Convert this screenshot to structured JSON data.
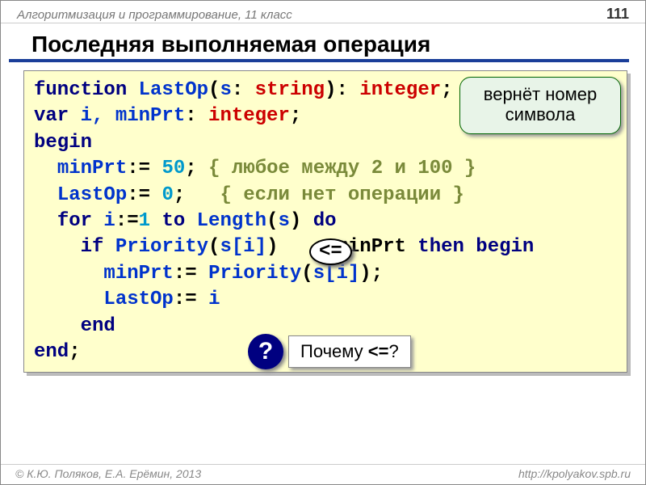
{
  "header": {
    "course": "Алгоритмизация и программирование, 11 класс",
    "page": "111"
  },
  "title": "Последняя выполняемая операция",
  "code": {
    "l1": {
      "kw1": "function ",
      "name": "LastOp",
      "paren1": "(",
      "p": "s",
      "colon1": ": ",
      "t1": "string",
      "paren2": "): ",
      "t2": "integer",
      "semi": ";"
    },
    "l2": {
      "kw": "var ",
      "vars": "i, minPrt",
      "colon": ": ",
      "t": "integer",
      "semi": ";"
    },
    "l3": {
      "kw": "begin"
    },
    "l4": {
      "indent": "  ",
      "v": "minPrt",
      "assign": ":= ",
      "n": "50",
      "semi": "; ",
      "c": "{ любое между 2 и 100 }"
    },
    "l5": {
      "indent": "  ",
      "v": "LastOp",
      "assign": ":= ",
      "n": "0",
      "semi": ";   ",
      "c": "{ если нет операции }"
    },
    "l6": {
      "indent": "  ",
      "kw1": "for ",
      "v": "i",
      "assign": ":=",
      "n": "1",
      "kw2": " to ",
      "fn": "Length",
      "paren1": "(",
      "arg": "s",
      "paren2": ") ",
      "kw3": "do"
    },
    "l7": {
      "indent": "    ",
      "kw1": "if ",
      "fn": "Priority",
      "paren1": "(",
      "arg": "s[i]",
      "paren2": ")    ",
      "rest": " minPrt ",
      "kw2": "then begin"
    },
    "l8": {
      "indent": "      ",
      "v": "minPrt",
      "assign": ":= ",
      "fn": "Priority",
      "paren1": "(",
      "arg": "s[i]",
      "paren2": ");"
    },
    "l9": {
      "indent": "      ",
      "v": "LastOp",
      "assign": ":= ",
      "rhs": "i"
    },
    "l10": {
      "indent": "    ",
      "kw": "end"
    },
    "l11": {
      "kw": "end",
      "semi": ";"
    }
  },
  "callouts": {
    "return_note": "вернёт номер\nсимвола",
    "op": "<=",
    "q_mark": "?",
    "question_pre": "Почему ",
    "question_op": "<=",
    "question_post": "?"
  },
  "footer": {
    "authors": "© К.Ю. Поляков, Е.А. Ерёмин, 2013",
    "url": "http://kpolyakov.spb.ru"
  }
}
